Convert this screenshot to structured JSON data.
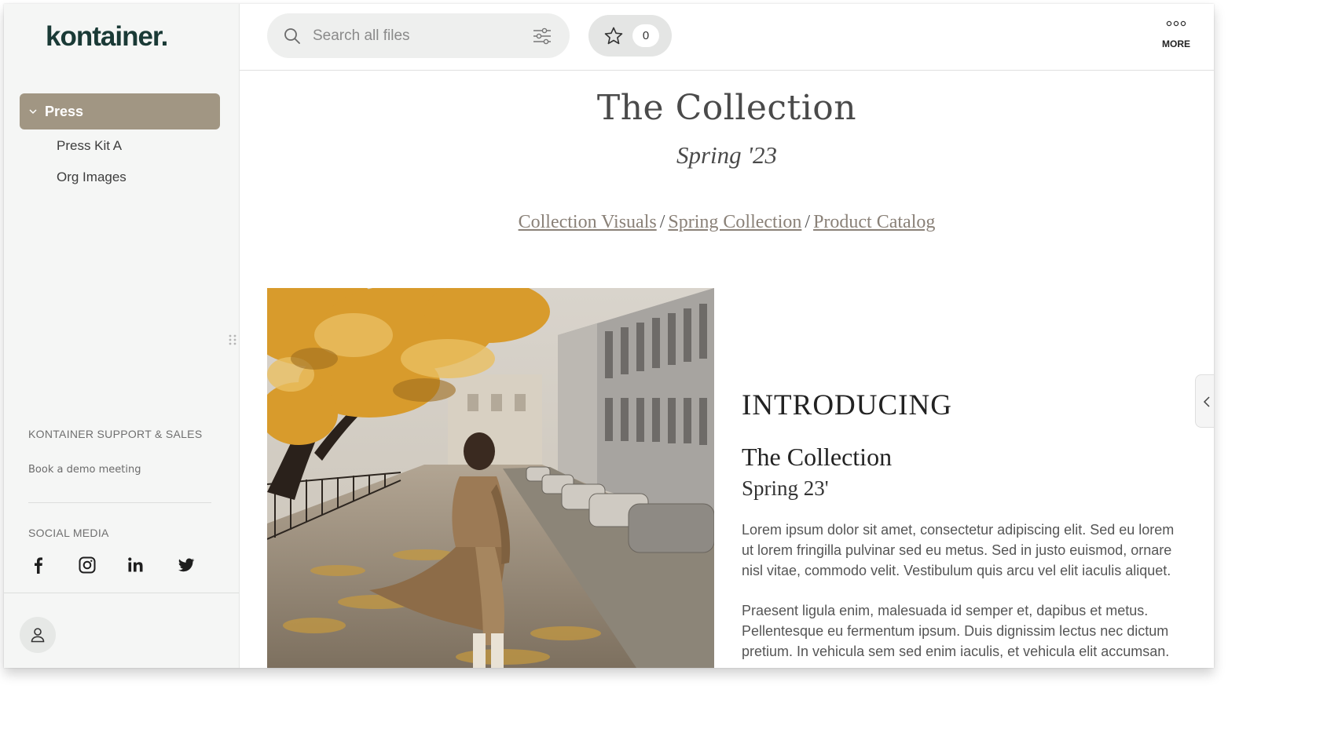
{
  "brand": {
    "logo_text": "kontainer."
  },
  "sidebar": {
    "active_item": {
      "label": "Press"
    },
    "sub_items": [
      {
        "label": "Press Kit A"
      },
      {
        "label": "Org Images"
      }
    ],
    "support": {
      "title": "KONTAINER SUPPORT & SALES",
      "link": "Book a demo meeting"
    },
    "social": {
      "title": "SOCIAL MEDIA",
      "icons": [
        "facebook-icon",
        "instagram-icon",
        "linkedin-icon",
        "twitter-icon"
      ]
    }
  },
  "header": {
    "search": {
      "placeholder": "Search all files",
      "value": ""
    },
    "favorites": {
      "count": "0"
    },
    "more": {
      "label": "MORE"
    }
  },
  "content": {
    "title": "The Collection",
    "subtitle": "Spring '23",
    "breadcrumbs": [
      "Collection Visuals",
      "Spring Collection",
      "Product Catalog"
    ],
    "breadcrumb_separator": "/",
    "intro": {
      "heading": "INTRODUCING",
      "title": "The Collection",
      "subtitle": "Spring 23'",
      "paragraphs": [
        "Lorem ipsum dolor sit amet, consectetur adipiscing elit. Sed eu lorem ut lorem fringilla pulvinar sed eu metus. Sed in justo euismod, ornare nisl vitae, commodo velit. Vestibulum quis arcu vel elit iaculis aliquet.",
        "Praesent ligula enim, malesuada id semper et, dapibus et metus. Pellentesque eu fermentum ipsum. Duis dignissim lectus nec dictum pretium. In vehicula sem sed enim iaculis, et vehicula elit accumsan."
      ]
    }
  },
  "colors": {
    "accent": "#a19683",
    "brand": "#1a3a36",
    "link": "#8a8178"
  }
}
